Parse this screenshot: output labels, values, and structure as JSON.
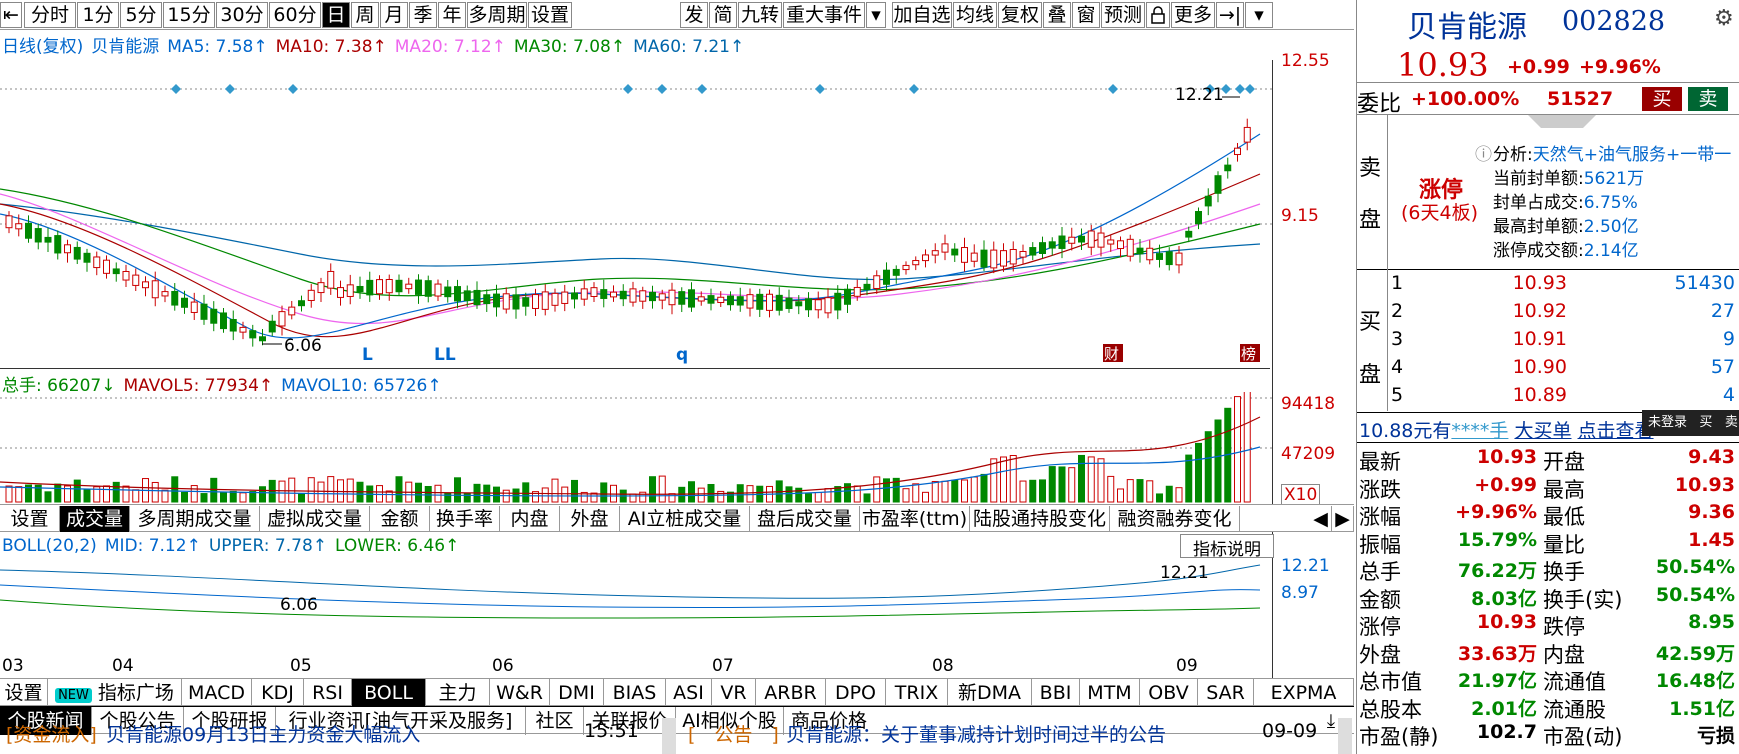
{
  "toolbar": {
    "periods": [
      "分时",
      "1分",
      "5分",
      "15分",
      "30分",
      "60分",
      "日",
      "周",
      "月",
      "季",
      "年",
      "多周期",
      "设置"
    ],
    "active_period": "日",
    "tools": [
      "发",
      "简",
      "九转",
      "重大事件",
      "▾",
      "加自选",
      "均线",
      "复权",
      "叠",
      "窗",
      "预测",
      "",
      "更多",
      "→|",
      "▾"
    ]
  },
  "kline": {
    "legend": {
      "title": "日线(复权)",
      "stock": "贝肯能源",
      "ma5": "MA5: 7.58↑",
      "ma10": "MA10: 7.38↑",
      "ma20": "MA20: 7.12↑",
      "ma30": "MA30: 7.08↑",
      "ma60": "MA60: 7.21↑"
    },
    "y_top": "12.55",
    "y_mid": "9.15",
    "high_label": "12.21",
    "low_label": "6.06",
    "markers": [
      "L",
      "LL",
      "q"
    ],
    "badges": [
      "财",
      "榜"
    ]
  },
  "volume": {
    "legend": {
      "total": "总手: 66207↓",
      "mavol5": "MAVOL5: 77934↑",
      "mavol10": "MAVOL10: 65726↑"
    },
    "y_top": "94418",
    "y_mid": "47209",
    "unit": "X10"
  },
  "indicator_tabs": [
    "设置",
    "成交量",
    "多周期成交量",
    "虚拟成交量",
    "金额",
    "换手率",
    "内盘",
    "外盘",
    "AI立桩成交量",
    "盘后成交量",
    "市盈率(ttm)",
    "陆股通持股变化",
    "融资融券变化"
  ],
  "indicator_active": "成交量",
  "boll": {
    "legend": {
      "title": "BOLL(20,2)",
      "mid": "MID: 7.12↑",
      "upper": "UPPER: 7.78↑",
      "lower": "LOWER: 6.46↑"
    },
    "y_top": "12.21",
    "y_mid": "8.97",
    "high_label": "12.21",
    "low_label": "6.06",
    "explain": "指标说明"
  },
  "months": [
    "03",
    "04",
    "05",
    "06",
    "07",
    "08",
    "09"
  ],
  "bottom_indicators": [
    "设置",
    "NEW",
    "指标广场",
    "MACD",
    "KDJ",
    "RSI",
    "BOLL",
    "主力",
    "W&R",
    "DMI",
    "BIAS",
    "ASI",
    "VR",
    "ARBR",
    "DPO",
    "TRIX",
    "新DMA",
    "BBI",
    "MTM",
    "OBV",
    "SAR",
    "EXPMA"
  ],
  "bottom_active": "BOLL",
  "news_tabs": [
    "个股新闻",
    "个股公告",
    "个股研报",
    "行业资讯[油气开采及服务]",
    "社区",
    "关联报价",
    "AI相似个股",
    "商品价格"
  ],
  "news_active": "个股新闻",
  "news": [
    {
      "tag": "[资金流入]",
      "title": "贝肯能源09月13日主力资金大幅流入",
      "time": "15:51"
    },
    {
      "tag": "[　公告　]",
      "title": "贝肯能源：关于董事减持计划时间过半的公告",
      "time": "09-09"
    }
  ],
  "panel": {
    "name": "贝肯能源",
    "code": "002828",
    "price": "10.93",
    "change": "+0.99",
    "pct": "+9.96%",
    "weibi_label": "委比",
    "weibi": "+100.00%",
    "weicha": "51527",
    "buy": "买",
    "sell": "卖",
    "sell_label": [
      "卖",
      "盘"
    ],
    "limit_title": "涨停",
    "limit_sub": "(6天4板)",
    "analysis_label": "分析:",
    "analysis": "天然气+油气服务+一带一",
    "seal_amt_label": "当前封单额:",
    "seal_amt": "5621万",
    "seal_ratio_label": "封单占成交:",
    "seal_ratio": "6.75%",
    "max_seal_label": "最高封单额:",
    "max_seal": "2.50亿",
    "limit_turn_label": "涨停成交额:",
    "limit_turn": "2.14亿",
    "buy_label": [
      "买",
      "盘"
    ],
    "bids": [
      {
        "lv": "1",
        "price": "10.93",
        "vol": "51430"
      },
      {
        "lv": "2",
        "price": "10.92",
        "vol": "27"
      },
      {
        "lv": "3",
        "price": "10.91",
        "vol": "9"
      },
      {
        "lv": "4",
        "price": "10.90",
        "vol": "57"
      },
      {
        "lv": "5",
        "price": "10.89",
        "vol": "4"
      }
    ],
    "bigorder": {
      "price": "10.88元有",
      "mask": "****手",
      "link": "大买单",
      "tail": "点击查看"
    },
    "login": {
      "status": "未登录",
      "b": "买",
      "s": "卖"
    },
    "stats": [
      {
        "l1": "最新",
        "v1": "10.93",
        "c1": "red",
        "l2": "开盘",
        "v2": "9.43",
        "c2": "red"
      },
      {
        "l1": "涨跌",
        "v1": "+0.99",
        "c1": "red",
        "l2": "最高",
        "v2": "10.93",
        "c2": "red"
      },
      {
        "l1": "涨幅",
        "v1": "+9.96%",
        "c1": "red",
        "l2": "最低",
        "v2": "9.36",
        "c2": "red"
      },
      {
        "l1": "振幅",
        "v1": "15.79%",
        "c1": "green",
        "l2": "量比",
        "v2": "1.45",
        "c2": "red"
      },
      {
        "l1": "总手",
        "v1": "76.22万",
        "c1": "green",
        "l2": "换手",
        "v2": "50.54%",
        "c2": "green"
      },
      {
        "l1": "金额",
        "v1": "8.03亿",
        "c1": "green",
        "l2": "换手(实)",
        "v2": "50.54%",
        "c2": "green"
      },
      {
        "l1": "涨停",
        "v1": "10.93",
        "c1": "red",
        "l2": "跌停",
        "v2": "8.95",
        "c2": "green"
      },
      {
        "l1": "外盘",
        "v1": "33.63万",
        "c1": "red",
        "l2": "内盘",
        "v2": "42.59万",
        "c2": "green"
      },
      {
        "l1": "总市值",
        "v1": "21.97亿",
        "c1": "green",
        "l2": "流通值",
        "v2": "16.48亿",
        "c2": "green"
      },
      {
        "l1": "总股本",
        "v1": "2.01亿",
        "c1": "green",
        "l2": "流通股",
        "v2": "1.51亿",
        "c2": "green"
      },
      {
        "l1": "市盈(静)",
        "v1": "102.7",
        "c1": "black",
        "l2": "市盈(动)",
        "v2": "亏损",
        "c2": "black"
      }
    ]
  }
}
